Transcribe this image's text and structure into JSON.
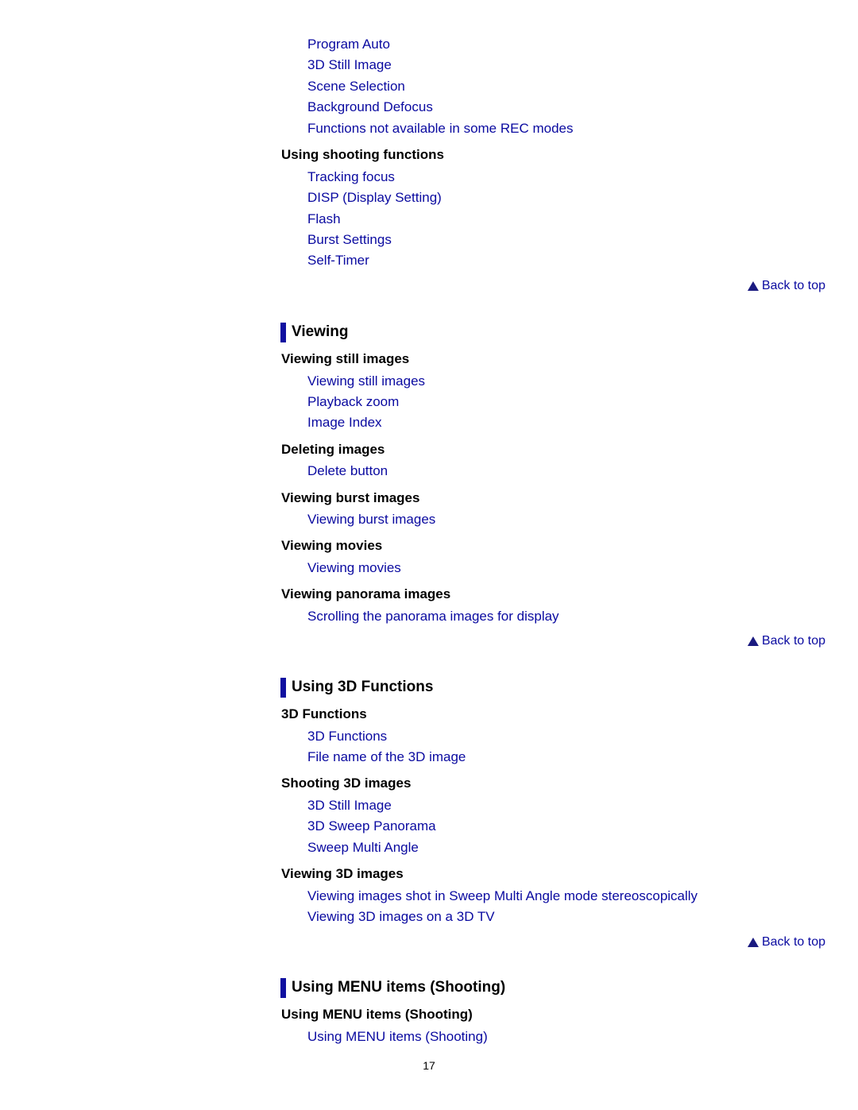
{
  "top_links": [
    "Program Auto",
    "3D Still Image",
    "Scene Selection",
    "Background Defocus",
    "Functions not available in some REC modes"
  ],
  "shooting_functions": {
    "heading": "Using shooting functions",
    "links": [
      "Tracking focus",
      "DISP (Display Setting)",
      "Flash",
      "Burst Settings",
      "Self-Timer"
    ]
  },
  "back_to_top": "Back to top",
  "viewing": {
    "title": "Viewing",
    "groups": [
      {
        "heading": "Viewing still images",
        "links": [
          "Viewing still images",
          "Playback zoom",
          "Image Index"
        ]
      },
      {
        "heading": "Deleting images",
        "links": [
          "Delete button"
        ]
      },
      {
        "heading": "Viewing burst images",
        "links": [
          "Viewing burst images"
        ]
      },
      {
        "heading": "Viewing movies",
        "links": [
          "Viewing movies"
        ]
      },
      {
        "heading": "Viewing panorama images",
        "links": [
          "Scrolling the panorama images for display"
        ]
      }
    ]
  },
  "using_3d": {
    "title": "Using 3D Functions",
    "groups": [
      {
        "heading": "3D Functions",
        "links": [
          "3D Functions",
          "File name of the 3D image"
        ]
      },
      {
        "heading": "Shooting 3D images",
        "links": [
          "3D Still Image",
          "3D Sweep Panorama",
          "Sweep Multi Angle"
        ]
      },
      {
        "heading": "Viewing 3D images",
        "links": [
          "Viewing images shot in Sweep Multi Angle mode stereoscopically",
          "Viewing 3D images on a 3D TV"
        ]
      }
    ]
  },
  "menu_shooting": {
    "title": "Using MENU items (Shooting)",
    "groups": [
      {
        "heading": "Using MENU items (Shooting)",
        "links": [
          "Using MENU items (Shooting)"
        ]
      }
    ]
  },
  "page_number": "17"
}
